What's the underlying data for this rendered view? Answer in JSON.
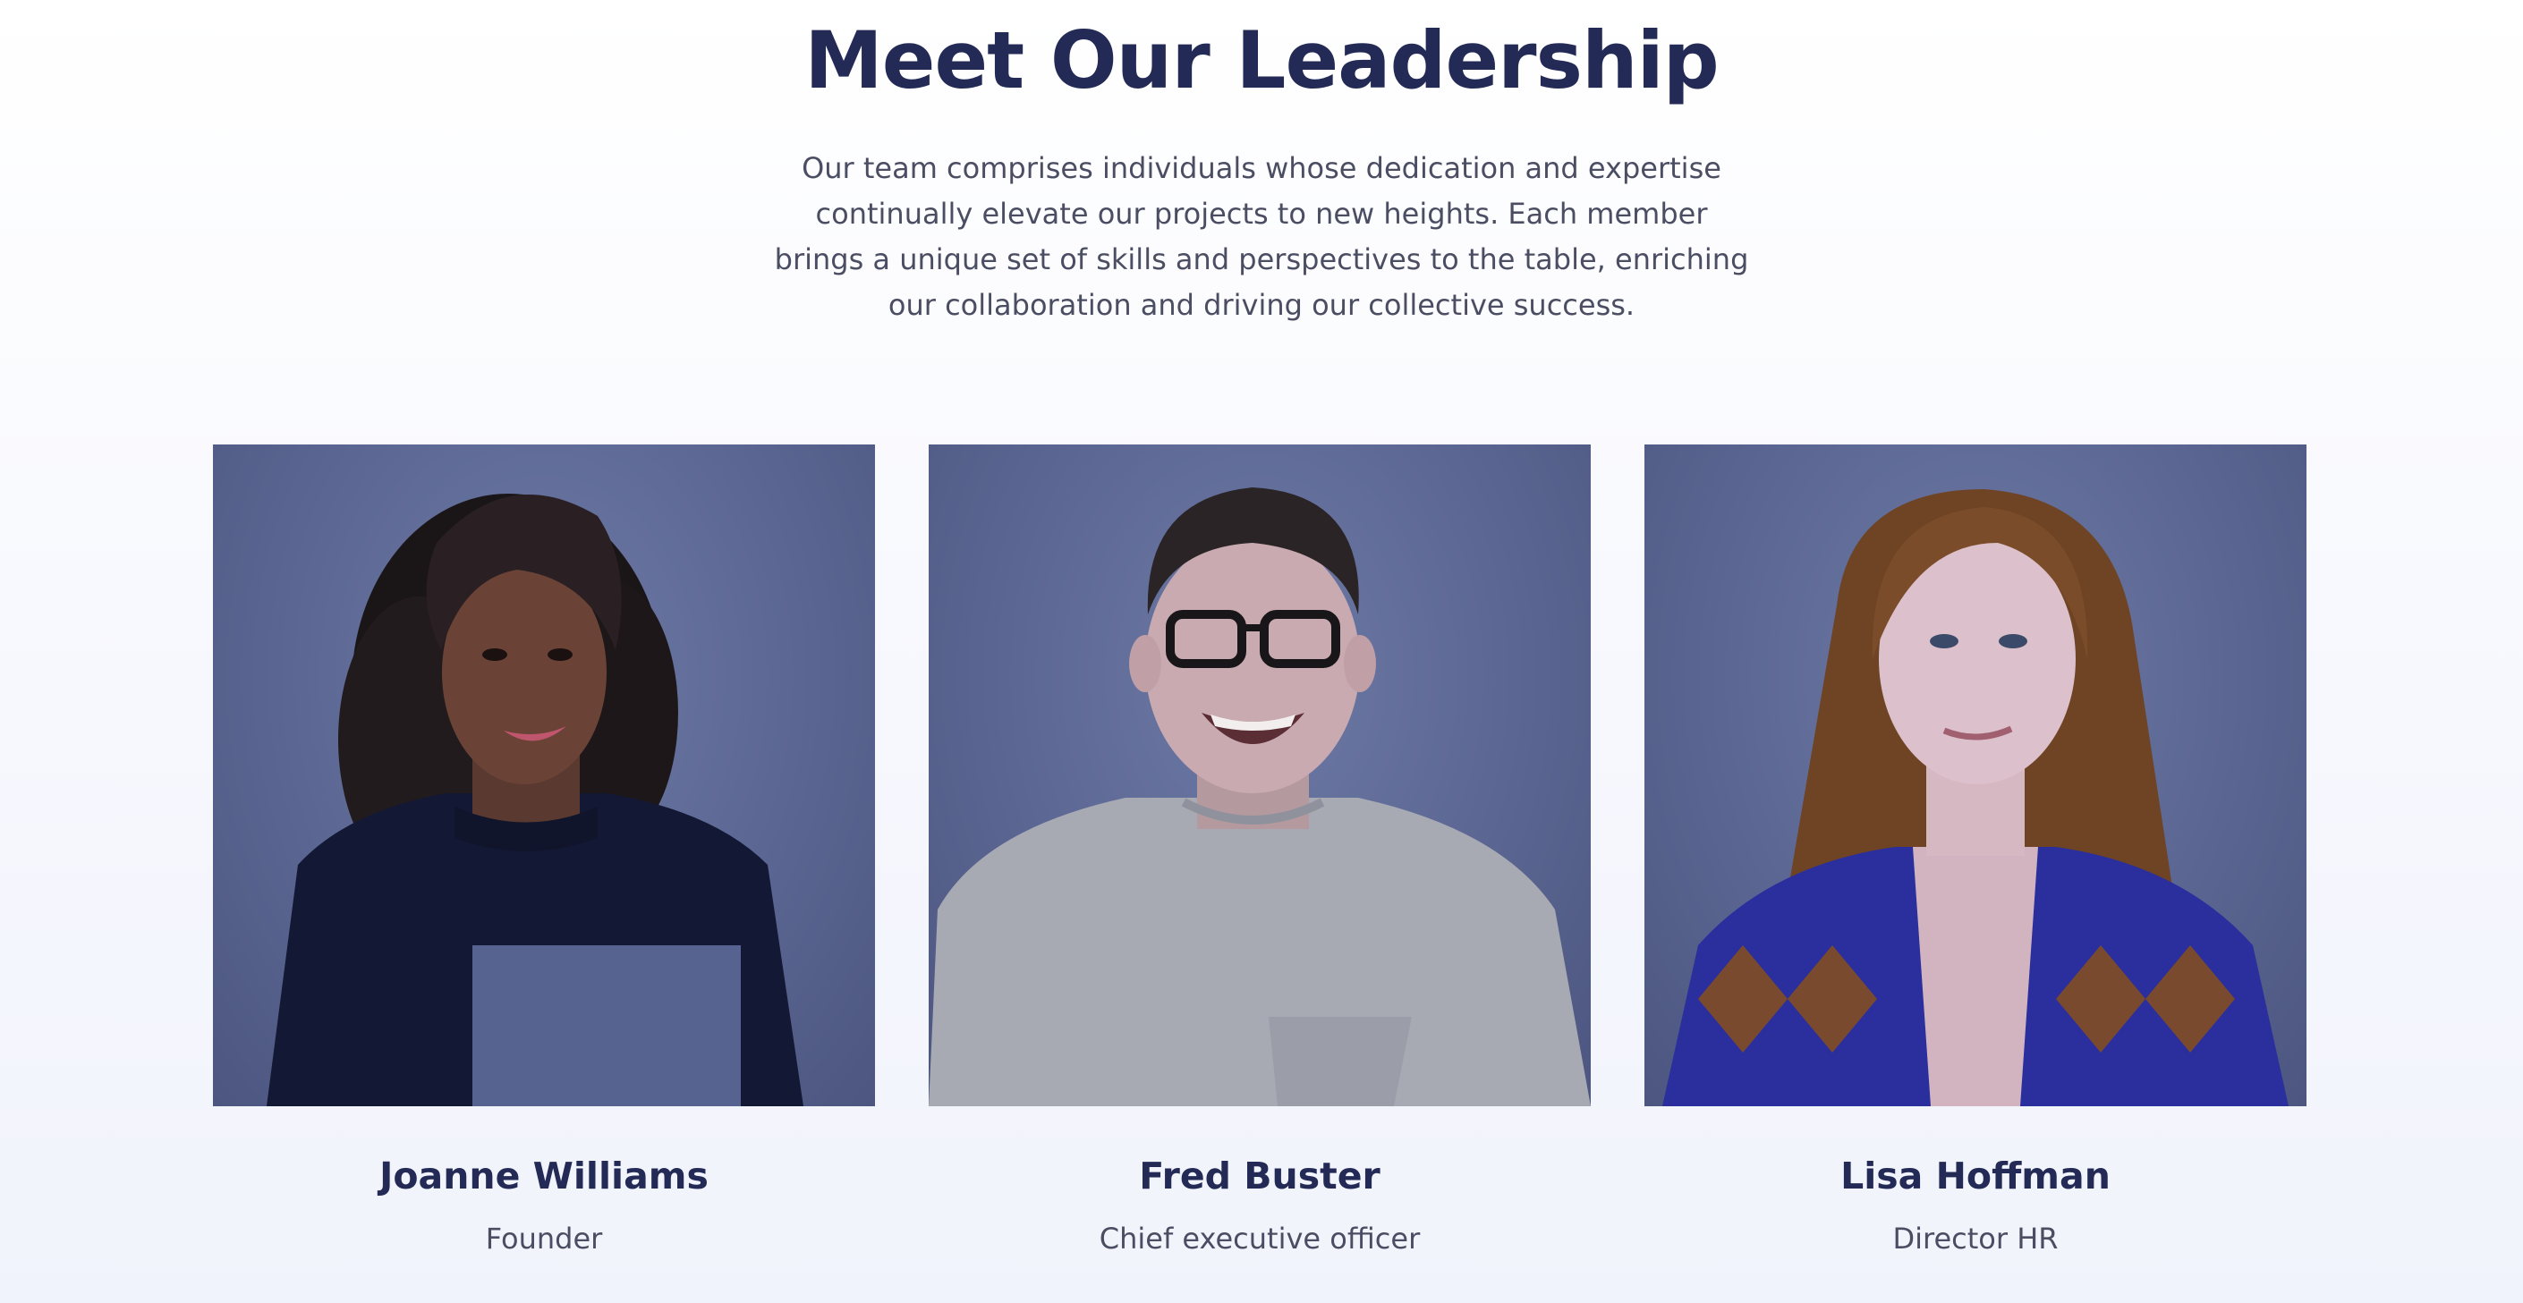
{
  "section": {
    "title": "Meet Our Leadership",
    "intro": "Our team comprises individuals whose dedication and expertise continually elevate our projects to new heights. Each member brings a unique set of skills and perspectives to the table, enriching our collaboration and driving our collective success."
  },
  "team": [
    {
      "name": "Joanne Williams",
      "role": "Founder"
    },
    {
      "name": "Fred Buster",
      "role": "Chief executive officer"
    },
    {
      "name": "Lisa Hoffman",
      "role": "Director HR"
    }
  ],
  "colors": {
    "heading": "#232a55",
    "body_text": "#4b4e63",
    "photo_background": "#5b6692"
  }
}
